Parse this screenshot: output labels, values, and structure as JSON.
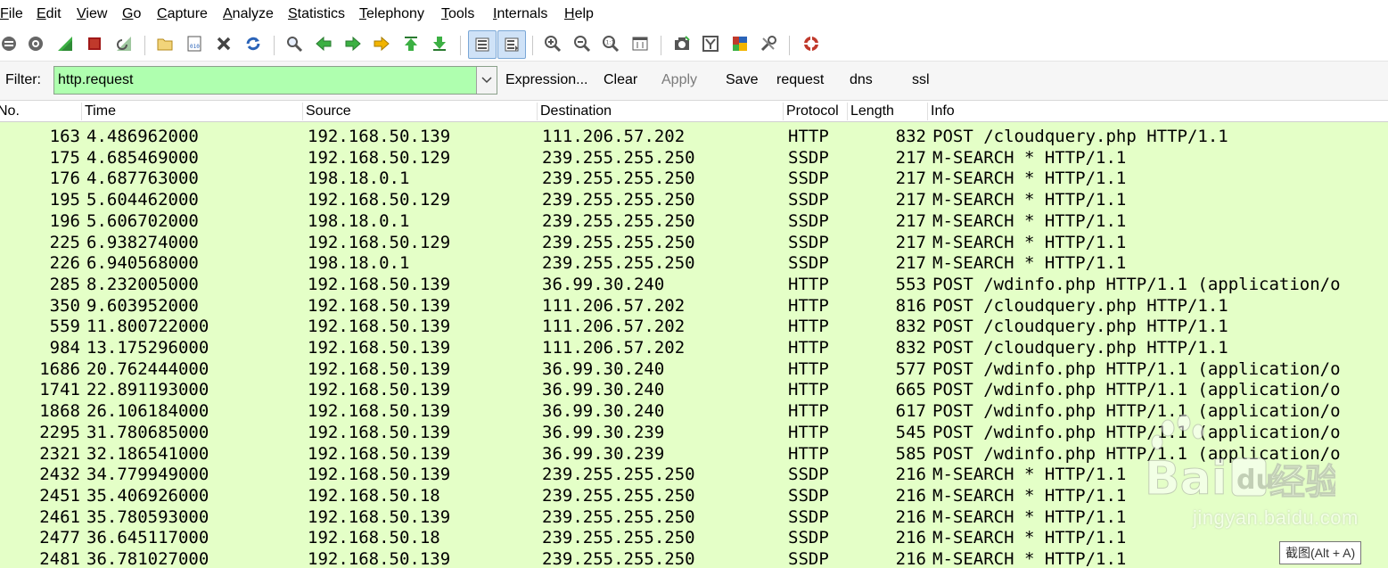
{
  "menubar": {
    "items": [
      {
        "label": "File"
      },
      {
        "label": "Edit"
      },
      {
        "label": "View"
      },
      {
        "label": "Go"
      },
      {
        "label": "Capture"
      },
      {
        "label": "Analyze"
      },
      {
        "label": "Statistics"
      },
      {
        "label": "Telephony"
      },
      {
        "label": "Tools"
      },
      {
        "label": "Internals"
      },
      {
        "label": "Help"
      }
    ]
  },
  "toolbar": {
    "icons": [
      "interfaces-icon",
      "options-icon",
      "start-capture-icon",
      "stop-capture-icon",
      "restart-capture-icon",
      "open-file-icon",
      "save-file-icon",
      "close-file-icon",
      "reload-icon",
      "find-packet-icon",
      "go-back-icon",
      "go-forward-icon",
      "go-to-packet-icon",
      "go-first-icon",
      "go-last-icon",
      "colorize-icon",
      "autoscroll-icon",
      "zoom-in-icon",
      "zoom-out-icon",
      "normal-size-icon",
      "resize-columns-icon",
      "capture-filters-icon",
      "display-filters-icon",
      "coloring-rules-icon",
      "preferences-icon",
      "help-icon"
    ],
    "colors": {
      "green": "#3cb043",
      "red": "#c0392b",
      "blue": "#2a63b8",
      "yellow": "#f2b400",
      "gray": "#555555"
    }
  },
  "filter": {
    "label": "Filter:",
    "value": "http.request",
    "bg_color": "#afffaf",
    "buttons": [
      {
        "label": "Expression...",
        "enabled": true
      },
      {
        "label": "Clear",
        "enabled": true
      },
      {
        "label": "Apply",
        "enabled": false
      },
      {
        "label": "Save",
        "enabled": true
      },
      {
        "label": "request",
        "enabled": true
      },
      {
        "label": "dns",
        "enabled": true
      },
      {
        "label": "ssl",
        "enabled": true
      }
    ]
  },
  "packet_list": {
    "columns": [
      "No.",
      "Time",
      "Source",
      "Destination",
      "Protocol",
      "Length",
      "Info"
    ],
    "row_color": "#e4ffc7",
    "rows": [
      {
        "no": "163",
        "time": "4.486962000",
        "src": "192.168.50.139",
        "dst": "111.206.57.202",
        "proto": "HTTP",
        "len": "832",
        "info": "POST /cloudquery.php HTTP/1.1"
      },
      {
        "no": "175",
        "time": "4.685469000",
        "src": "192.168.50.129",
        "dst": "239.255.255.250",
        "proto": "SSDP",
        "len": "217",
        "info": "M-SEARCH * HTTP/1.1"
      },
      {
        "no": "176",
        "time": "4.687763000",
        "src": "198.18.0.1",
        "dst": "239.255.255.250",
        "proto": "SSDP",
        "len": "217",
        "info": "M-SEARCH * HTTP/1.1"
      },
      {
        "no": "195",
        "time": "5.604462000",
        "src": "192.168.50.129",
        "dst": "239.255.255.250",
        "proto": "SSDP",
        "len": "217",
        "info": "M-SEARCH * HTTP/1.1"
      },
      {
        "no": "196",
        "time": "5.606702000",
        "src": "198.18.0.1",
        "dst": "239.255.255.250",
        "proto": "SSDP",
        "len": "217",
        "info": "M-SEARCH * HTTP/1.1"
      },
      {
        "no": "225",
        "time": "6.938274000",
        "src": "192.168.50.129",
        "dst": "239.255.255.250",
        "proto": "SSDP",
        "len": "217",
        "info": "M-SEARCH * HTTP/1.1"
      },
      {
        "no": "226",
        "time": "6.940568000",
        "src": "198.18.0.1",
        "dst": "239.255.255.250",
        "proto": "SSDP",
        "len": "217",
        "info": "M-SEARCH * HTTP/1.1"
      },
      {
        "no": "285",
        "time": "8.232005000",
        "src": "192.168.50.139",
        "dst": "36.99.30.240",
        "proto": "HTTP",
        "len": "553",
        "info": "POST /wdinfo.php HTTP/1.1  (application/o"
      },
      {
        "no": "350",
        "time": "9.603952000",
        "src": "192.168.50.139",
        "dst": "111.206.57.202",
        "proto": "HTTP",
        "len": "816",
        "info": "POST /cloudquery.php HTTP/1.1"
      },
      {
        "no": "559",
        "time": "11.800722000",
        "src": "192.168.50.139",
        "dst": "111.206.57.202",
        "proto": "HTTP",
        "len": "832",
        "info": "POST /cloudquery.php HTTP/1.1"
      },
      {
        "no": "984",
        "time": "13.175296000",
        "src": "192.168.50.139",
        "dst": "111.206.57.202",
        "proto": "HTTP",
        "len": "832",
        "info": "POST /cloudquery.php HTTP/1.1"
      },
      {
        "no": "1686",
        "time": "20.762444000",
        "src": "192.168.50.139",
        "dst": "36.99.30.240",
        "proto": "HTTP",
        "len": "577",
        "info": "POST /wdinfo.php HTTP/1.1  (application/o"
      },
      {
        "no": "1741",
        "time": "22.891193000",
        "src": "192.168.50.139",
        "dst": "36.99.30.240",
        "proto": "HTTP",
        "len": "665",
        "info": "POST /wdinfo.php HTTP/1.1  (application/o"
      },
      {
        "no": "1868",
        "time": "26.106184000",
        "src": "192.168.50.139",
        "dst": "36.99.30.240",
        "proto": "HTTP",
        "len": "617",
        "info": "POST /wdinfo.php HTTP/1.1  (application/o"
      },
      {
        "no": "2295",
        "time": "31.780685000",
        "src": "192.168.50.139",
        "dst": "36.99.30.239",
        "proto": "HTTP",
        "len": "545",
        "info": "POST /wdinfo.php HTTP/1.1  (application/o"
      },
      {
        "no": "2321",
        "time": "32.186541000",
        "src": "192.168.50.139",
        "dst": "36.99.30.239",
        "proto": "HTTP",
        "len": "585",
        "info": "POST /wdinfo.php HTTP/1.1  (application/o"
      },
      {
        "no": "2432",
        "time": "34.779949000",
        "src": "192.168.50.139",
        "dst": "239.255.255.250",
        "proto": "SSDP",
        "len": "216",
        "info": "M-SEARCH * HTTP/1.1"
      },
      {
        "no": "2451",
        "time": "35.406926000",
        "src": "192.168.50.18",
        "dst": "239.255.255.250",
        "proto": "SSDP",
        "len": "216",
        "info": "M-SEARCH * HTTP/1.1"
      },
      {
        "no": "2461",
        "time": "35.780593000",
        "src": "192.168.50.139",
        "dst": "239.255.255.250",
        "proto": "SSDP",
        "len": "216",
        "info": "M-SEARCH * HTTP/1.1"
      },
      {
        "no": "2477",
        "time": "36.645117000",
        "src": "192.168.50.18",
        "dst": "239.255.255.250",
        "proto": "SSDP",
        "len": "216",
        "info": "M-SEARCH * HTTP/1.1"
      },
      {
        "no": "2481",
        "time": "36.781027000",
        "src": "192.168.50.139",
        "dst": "239.255.255.250",
        "proto": "SSDP",
        "len": "216",
        "info": "M-SEARCH * HTTP/1.1"
      }
    ]
  },
  "watermark": {
    "text": "jingyan.baidu.com"
  },
  "tooltip": {
    "text": "截图(Alt + A)"
  }
}
